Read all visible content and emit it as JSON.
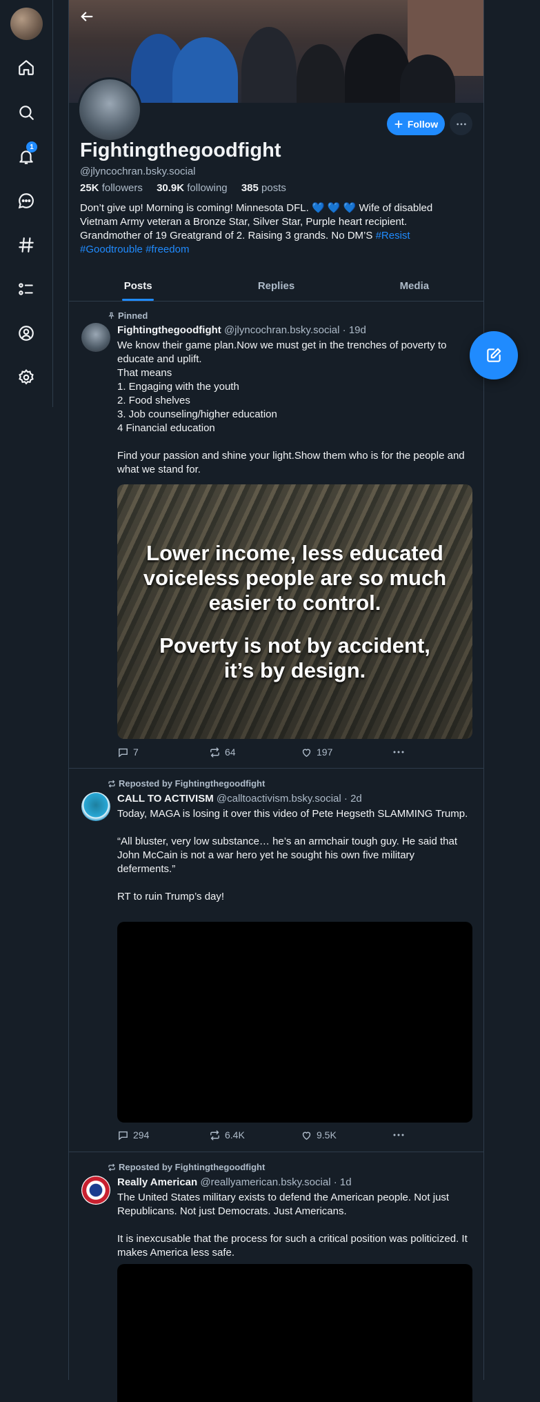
{
  "rail": {
    "notification_count": "1"
  },
  "profile": {
    "display_name": "Fightingthegoodfight",
    "handle": "@jlyncochran.bsky.social",
    "followers_count": "25K",
    "followers_label": "followers",
    "following_count": "30.9K",
    "following_label": "following",
    "posts_count": "385",
    "posts_label": "posts",
    "bio_text": "Don’t give up! Morning is coming!  Minnesota DFL. 💙 💙 💙 Wife of disabled Vietnam Army veteran a Bronze Star, Silver Star, Purple heart recipient. Grandmother of 19 Greatgrand of 2. Raising 3 grands. No DM’S ",
    "bio_tags": [
      "#Resist",
      "#Goodtrouble",
      "#freedom"
    ],
    "follow_label": "Follow"
  },
  "tabs": [
    {
      "label": "Posts",
      "active": true
    },
    {
      "label": "Replies",
      "active": false
    },
    {
      "label": "Media",
      "active": false
    }
  ],
  "posts": [
    {
      "context": "Pinned",
      "author_name": "Fightingthegoodfight",
      "author_handle": "@jlyncochran.bsky.social",
      "age": "19d",
      "text": "We know their game plan.Now we must get in the trenches of poverty to educate and uplift.\nThat means\n1. Engaging with the youth\n2. Food shelves\n3. Job counseling/higher education\n4 Financial education\n\nFind your passion and shine your light.Show them who is for the people and what we stand for.",
      "image_text_1": "Lower income, less educated voiceless people are so much easier to control.",
      "image_text_2": "Poverty is not by accident, it’s by design.",
      "replies": "7",
      "reposts": "64",
      "likes": "197"
    },
    {
      "context": "Reposted by Fightingthegoodfight",
      "author_name": "CALL TO ACTIVISM",
      "author_handle": "@calltoactivism.bsky.social",
      "age": "2d",
      "text": "Today, MAGA is losing it over this video of Pete Hegseth SLAMMING Trump.\n\n“All bluster, very low substance… he’s an armchair tough guy. He said that John McCain is not a war hero yet he sought his own five military deferments.”\n\nRT to ruin Trump’s day!",
      "replies": "294",
      "reposts": "6.4K",
      "likes": "9.5K"
    },
    {
      "context": "Reposted by Fightingthegoodfight",
      "author_name": "Really American",
      "author_handle": "@reallyamerican.bsky.social",
      "age": "1d",
      "text": "The United States military exists to defend the American people. Not just Republicans. Not just Democrats. Just Americans.\n\nIt is inexcusable that the process for such a critical position was politicized. It makes America less safe."
    }
  ],
  "colors": {
    "background": "#161e27",
    "accent": "#208bfe",
    "muted_text": "#aebbc9",
    "border": "#2e3c4b"
  },
  "icons": [
    "home-icon",
    "search-icon",
    "bell-icon",
    "chat-icon",
    "hashtag-icon",
    "list-icon",
    "profile-icon",
    "gear-icon",
    "back-arrow-icon",
    "plus-icon",
    "ellipsis-icon",
    "pin-icon",
    "repost-icon",
    "reply-icon",
    "like-icon",
    "compose-icon"
  ]
}
